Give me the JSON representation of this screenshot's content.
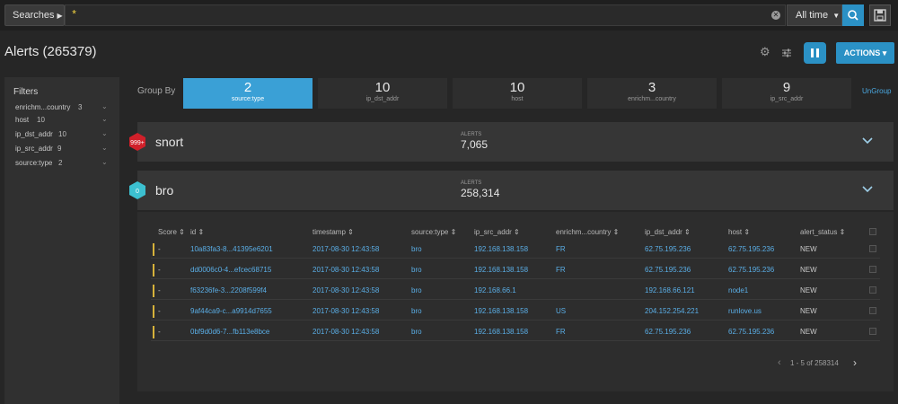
{
  "searchbar": {
    "searches_label": "Searches",
    "query": "*",
    "time_range": "All time"
  },
  "header": {
    "title": "Alerts (265379)",
    "actions_label": "ACTIONS"
  },
  "filters": {
    "title": "Filters",
    "items": [
      {
        "name": "enrichm...country",
        "count": "3"
      },
      {
        "name": "host",
        "count": "10"
      },
      {
        "name": "ip_dst_addr",
        "count": "10"
      },
      {
        "name": "ip_src_addr",
        "count": "9"
      },
      {
        "name": "source:type",
        "count": "2"
      }
    ]
  },
  "groupby": {
    "label": "Group By",
    "ungroup_label": "UnGroup",
    "tiles": [
      {
        "count": "2",
        "name": "source:type",
        "active": true
      },
      {
        "count": "10",
        "name": "ip_dst_addr",
        "active": false
      },
      {
        "count": "10",
        "name": "host",
        "active": false
      },
      {
        "count": "3",
        "name": "enrichm...country",
        "active": false
      },
      {
        "count": "9",
        "name": "ip_src_addr",
        "active": false
      }
    ]
  },
  "groups": [
    {
      "name": "snort",
      "badge": "999+",
      "badge_color": "#d0202a",
      "alerts_label": "ALERTS",
      "alerts": "7,065"
    },
    {
      "name": "bro",
      "badge": "0",
      "badge_color": "#3cc0d0",
      "alerts_label": "ALERTS",
      "alerts": "258,314"
    }
  ],
  "table": {
    "columns": [
      "Score",
      "id",
      "timestamp",
      "source:type",
      "ip_src_addr",
      "enrichm...country",
      "ip_dst_addr",
      "host",
      "alert_status"
    ],
    "rows": [
      {
        "score": "-",
        "id": "10a83fa3-8...41395e6201",
        "timestamp": "2017-08-30 12:43:58",
        "source_type": "bro",
        "ip_src_addr": "192.168.138.158",
        "country": "FR",
        "ip_dst_addr": "62.75.195.236",
        "host": "62.75.195.236",
        "alert_status": "NEW"
      },
      {
        "score": "-",
        "id": "dd0006c0-4...efcec68715",
        "timestamp": "2017-08-30 12:43:58",
        "source_type": "bro",
        "ip_src_addr": "192.168.138.158",
        "country": "FR",
        "ip_dst_addr": "62.75.195.236",
        "host": "62.75.195.236",
        "alert_status": "NEW"
      },
      {
        "score": "-",
        "id": "f63236fe-3...2208f599f4",
        "timestamp": "2017-08-30 12:43:58",
        "source_type": "bro",
        "ip_src_addr": "192.168.66.1",
        "country": "",
        "ip_dst_addr": "192.168.66.121",
        "host": "node1",
        "alert_status": "NEW"
      },
      {
        "score": "-",
        "id": "9af44ca9-c...a9914d7655",
        "timestamp": "2017-08-30 12:43:58",
        "source_type": "bro",
        "ip_src_addr": "192.168.138.158",
        "country": "US",
        "ip_dst_addr": "204.152.254.221",
        "host": "runlove.us",
        "alert_status": "NEW"
      },
      {
        "score": "-",
        "id": "0bf9d0d6-7...fb113e8bce",
        "timestamp": "2017-08-30 12:43:58",
        "source_type": "bro",
        "ip_src_addr": "192.168.138.158",
        "country": "FR",
        "ip_dst_addr": "62.75.195.236",
        "host": "62.75.195.236",
        "alert_status": "NEW"
      }
    ],
    "pager": "1 - 5 of 258314"
  },
  "colors": {
    "accent": "#2b91c5",
    "active_tile": "#3aa0d6",
    "link": "#5aaee6",
    "score_bar": "#d6b23a"
  }
}
